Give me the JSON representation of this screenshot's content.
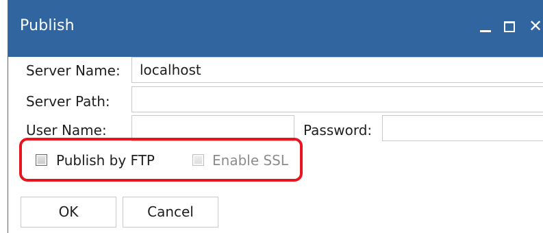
{
  "window": {
    "title": "Publish",
    "controls": {
      "minimize_icon": "minimize-icon",
      "maximize_icon": "maximize-icon",
      "close_icon": "close-icon"
    },
    "title_bar_color": "#31659f"
  },
  "form": {
    "server_name": {
      "label": "Server Name:",
      "value": "localhost"
    },
    "server_path": {
      "label": "Server Path:",
      "value": ""
    },
    "user_name": {
      "label": "User Name:",
      "value": ""
    },
    "password": {
      "label": "Password:",
      "value": ""
    }
  },
  "options": {
    "publish_by_ftp": {
      "label": "Publish by FTP",
      "checked": false,
      "enabled": true
    },
    "enable_ssl": {
      "label": "Enable SSL",
      "checked": false,
      "enabled": false
    },
    "highlight_color": "#e8141e"
  },
  "buttons": {
    "ok": "OK",
    "cancel": "Cancel"
  }
}
